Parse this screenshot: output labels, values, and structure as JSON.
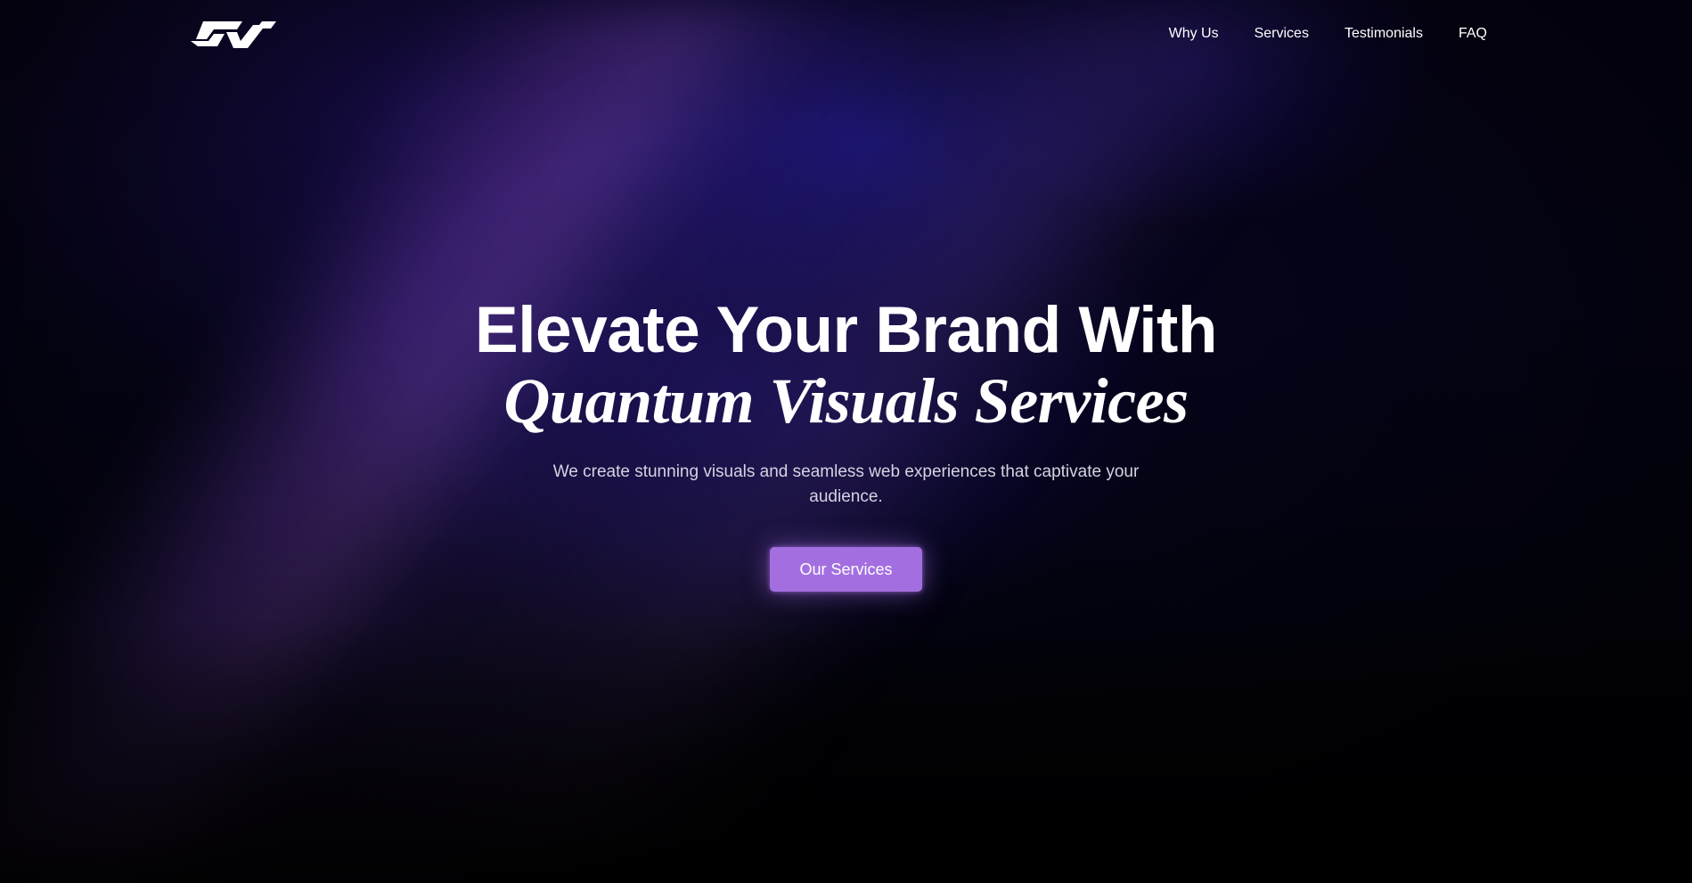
{
  "brand": {
    "logo_icon": "qv-logo-icon",
    "accent_color": "#a36fe0"
  },
  "nav": {
    "items": [
      {
        "label": "Why Us"
      },
      {
        "label": "Services"
      },
      {
        "label": "Testimonials"
      },
      {
        "label": "FAQ"
      }
    ]
  },
  "hero": {
    "title_line1": "Elevate Your Brand With",
    "title_line2": "Quantum Visuals Services",
    "subtitle": "We create stunning visuals and seamless web experiences that captivate your audience.",
    "cta_label": "Our Services"
  }
}
